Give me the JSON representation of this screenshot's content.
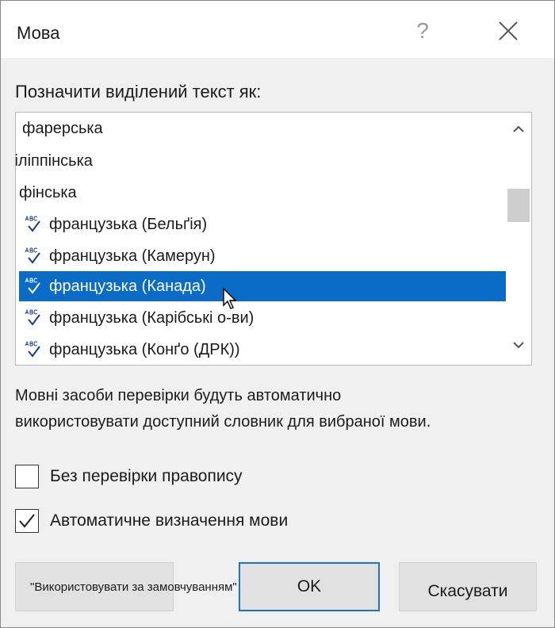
{
  "dialog": {
    "title": "Мова",
    "help_label": "?",
    "prompt": "Позначити виділений текст як:",
    "description_line1": "Мовні засоби перевірки будуть автоматично",
    "description_line2": "використовувати доступний словник для вибраної мови."
  },
  "languages": {
    "items": [
      {
        "label": "фарерська",
        "has_proofing": false,
        "selected": false
      },
      {
        "label": "філіппінська",
        "has_proofing": false,
        "selected": false
      },
      {
        "label": "фінська",
        "has_proofing": false,
        "selected": false
      },
      {
        "label": "французька (Бельґія)",
        "has_proofing": true,
        "selected": false
      },
      {
        "label": "французька (Камерун)",
        "has_proofing": true,
        "selected": false
      },
      {
        "label": "французька (Канада)",
        "has_proofing": true,
        "selected": true
      },
      {
        "label": "французька (Карібські о-ви)",
        "has_proofing": true,
        "selected": false
      },
      {
        "label": "французька (Конґо (ДРК))",
        "has_proofing": true,
        "selected": false
      }
    ]
  },
  "options": {
    "no_spellcheck_label": "Без перевірки правопису",
    "no_spellcheck_checked": false,
    "auto_detect_label": "Автоматичне визначення мови",
    "auto_detect_checked": true
  },
  "buttons": {
    "default_label": "\"Використовувати за замовчуванням\"",
    "ok_label": "OK",
    "cancel_label": "Скасувати"
  },
  "colors": {
    "selection": "#0b6cc8",
    "proofing_icon": "#1a3a8f",
    "ok_border": "#1a73cc"
  },
  "icons": {
    "proofing": "abc-check-icon",
    "close": "close-icon",
    "scroll_up": "chevron-up-icon",
    "scroll_down": "chevron-down-icon",
    "checkmark": "checkmark-icon",
    "cursor": "mouse-pointer-icon"
  }
}
